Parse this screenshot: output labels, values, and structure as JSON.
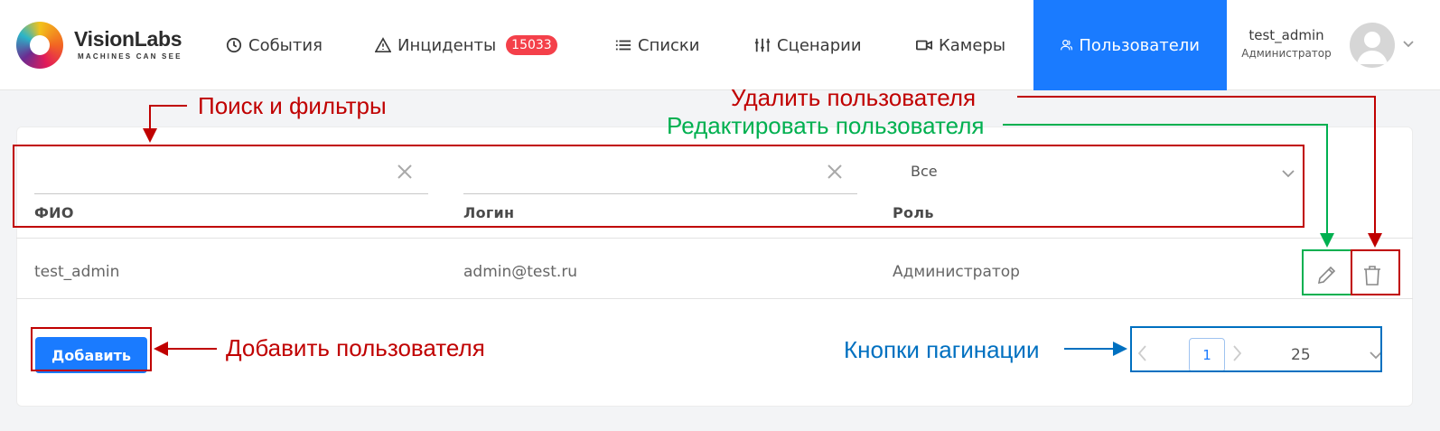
{
  "header": {
    "brand": "VisionLabs",
    "tagline": "MACHINES CAN SEE",
    "nav": [
      {
        "label": "События",
        "icon": "clock-icon"
      },
      {
        "label": "Инциденты",
        "icon": "warning-icon",
        "badge": "15033"
      },
      {
        "label": "Списки",
        "icon": "list-icon"
      },
      {
        "label": "Сценарии",
        "icon": "sliders-icon"
      },
      {
        "label": "Камеры",
        "icon": "camera-icon"
      },
      {
        "label": "Пользователи",
        "icon": "users-icon",
        "active": true
      }
    ],
    "user": {
      "name": "test_admin",
      "role": "Администратор"
    }
  },
  "filters": {
    "fio_label": "ФИО",
    "login_label": "Логин",
    "role_label": "Роль",
    "role_value": "Все"
  },
  "table": {
    "rows": [
      {
        "fio": "test_admin",
        "login": "admin@test.ru",
        "role": "Администратор"
      }
    ]
  },
  "footer": {
    "add_label": "Добавить",
    "current_page": "1",
    "per_page": "25"
  },
  "annotations": {
    "search_filters": "Поиск и фильтры",
    "delete_user": "Удалить пользователя",
    "edit_user": "Редактировать пользователя",
    "add_user": "Добавить пользователя",
    "pagination": "Кнопки пагинации"
  },
  "colors": {
    "accent": "#1a7bff",
    "badge": "#f4404a",
    "annotation_red": "#c00000",
    "annotation_green": "#00b050",
    "annotation_blue": "#0070c0"
  }
}
